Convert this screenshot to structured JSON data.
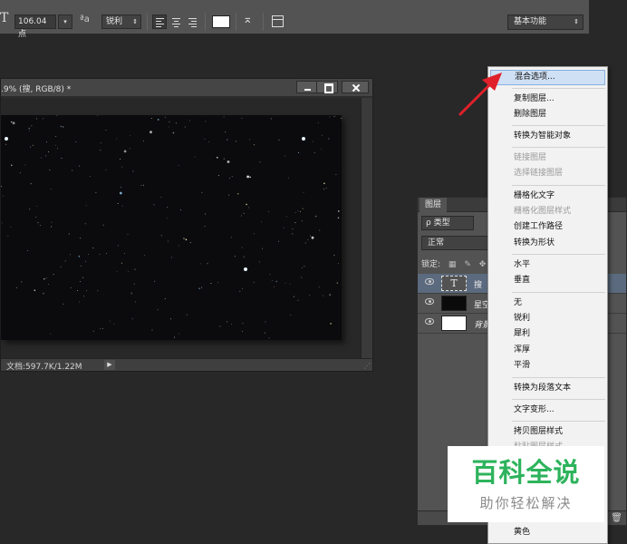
{
  "options_bar": {
    "tool_icon": "T",
    "font_size_value": "106.04 点",
    "aa_icon": "ªa",
    "antialias_value": "锐利",
    "text_color": "#ffffff",
    "workspace_value": "基本功能"
  },
  "document": {
    "title": ".9% (搜, RGB/8) *",
    "status": "文档:597.7K/1.22M"
  },
  "layers_panel": {
    "tab_label": "图层",
    "filter_value": "ρ 类型",
    "blend_value": "正常",
    "lock_label": "锁定:",
    "rows": [
      {
        "name": "搜",
        "thumb": "T",
        "selected": true
      },
      {
        "name": "星空",
        "thumb": "",
        "selected": false
      },
      {
        "name": "背景",
        "thumb": "",
        "selected": false
      }
    ]
  },
  "context_menu": {
    "items": [
      {
        "label": "混合选项...",
        "state": "highlight"
      },
      {
        "label": "复制图层...",
        "state": "normal"
      },
      {
        "label": "删除图层",
        "state": "normal"
      },
      {
        "label": "转换为智能对象",
        "state": "normal"
      },
      {
        "label": "链接图层",
        "state": "disabled"
      },
      {
        "label": "选择链接图层",
        "state": "disabled"
      },
      {
        "label": "栅格化文字",
        "state": "normal"
      },
      {
        "label": "栅格化图层样式",
        "state": "disabled"
      },
      {
        "label": "创建工作路径",
        "state": "normal"
      },
      {
        "label": "转换为形状",
        "state": "normal"
      },
      {
        "label": "水平",
        "state": "normal"
      },
      {
        "label": "垂直",
        "state": "normal"
      },
      {
        "label": "无",
        "state": "normal"
      },
      {
        "label": "锐利",
        "state": "normal"
      },
      {
        "label": "犀利",
        "state": "normal"
      },
      {
        "label": "浑厚",
        "state": "normal"
      },
      {
        "label": "平滑",
        "state": "normal"
      },
      {
        "label": "转换为段落文本",
        "state": "normal"
      },
      {
        "label": "文字变形...",
        "state": "normal"
      },
      {
        "label": "拷贝图层样式",
        "state": "normal"
      },
      {
        "label": "粘贴图层样式",
        "state": "disabled"
      },
      {
        "label": "黄色",
        "state": "normal"
      }
    ]
  },
  "watermark": {
    "title": "百科全说",
    "subtitle": "助你轻松解决"
  },
  "colors": {
    "menu_highlight": "#cfe0f4",
    "annotation_arrow": "#e0202a",
    "watermark_green": "#2db35c"
  }
}
